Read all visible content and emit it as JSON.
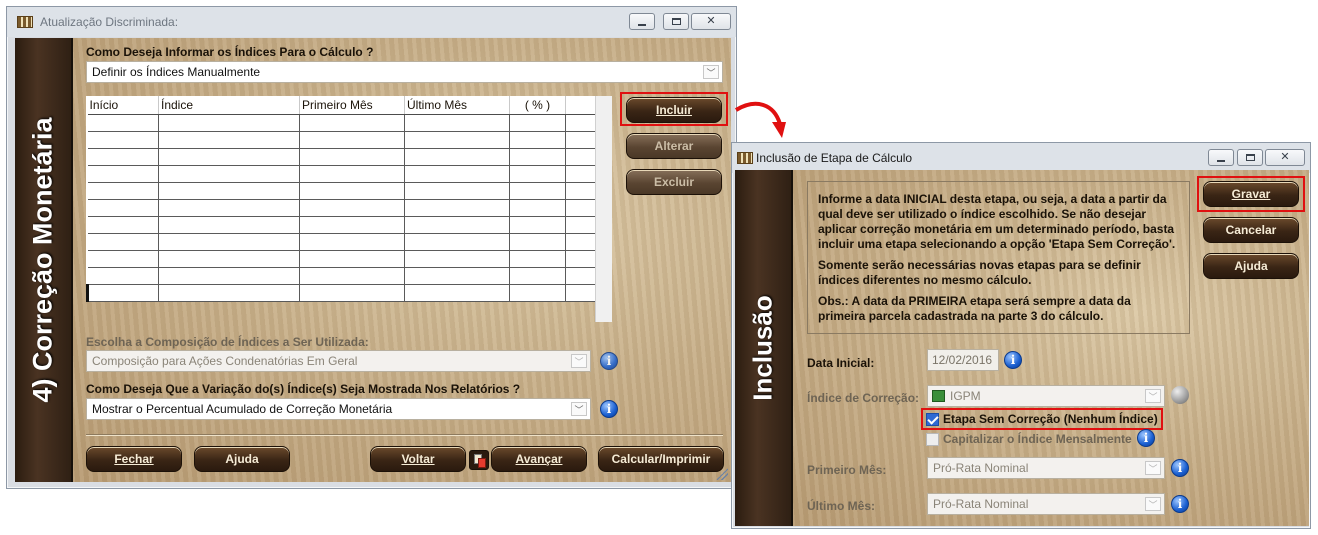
{
  "window1": {
    "title": "Atualização Discriminada:",
    "side_title": "4) Correção Monetária",
    "question1": "Como Deseja Informar os Índices Para o Cálculo ?",
    "select1_value": "Definir os Índices Manualmente",
    "table_headers": [
      "Início",
      "Índice",
      "Primeiro Mês",
      "Último Mês",
      "( % )",
      ""
    ],
    "buttons": {
      "incluir": "Incluir",
      "alterar": "Alterar",
      "excluir": "Excluir",
      "fechar": "Fechar",
      "ajuda": "Ajuda",
      "voltar": "Voltar",
      "avancar": "Avançar",
      "calcular": "Calcular/Imprimir"
    },
    "question2": "Escolha a Composição de Índices a Ser Utilizada:",
    "select2_value": "Composição para Ações Condenatórias Em Geral",
    "question3": "Como Deseja Que a Variação do(s) Índice(s) Seja Mostrada Nos Relatórios ?",
    "select3_value": "Mostrar o Percentual Acumulado de Correção Monetária"
  },
  "window2": {
    "title": "Inclusão de Etapa de Cálculo",
    "side_title": "Inclusão",
    "info_p1": "Informe a data INICIAL desta etapa, ou seja, a data a partir da qual deve ser utilizado o índice escolhido. Se não desejar aplicar correção monetária em um determinado período, basta incluir uma etapa selecionando a opção 'Etapa Sem Correção'.",
    "info_p2": "Somente serão necessárias novas etapas para se definir índices diferentes no mesmo cálculo.",
    "info_p3": "Obs.: A data da PRIMEIRA etapa será sempre a data da primeira parcela cadastrada na parte 3 do cálculo.",
    "buttons": {
      "gravar": "Gravar",
      "cancelar": "Cancelar",
      "ajuda": "Ajuda"
    },
    "data_inicial_label": "Data Inicial:",
    "data_inicial_value": "12/02/2016",
    "indice_label": "Índice de Correção:",
    "indice_value": "IGPM",
    "etapa_sem_correcao": "Etapa Sem Correção (Nenhum Índice)",
    "capitalizar": "Capitalizar o Índice Mensalmente",
    "primeiro_mes_label": "Primeiro Mês:",
    "primeiro_mes_value": "Pró-Rata Nominal",
    "ultimo_mes_label": "Último Mês:",
    "ultimo_mes_value": "Pró-Rata Nominal"
  }
}
